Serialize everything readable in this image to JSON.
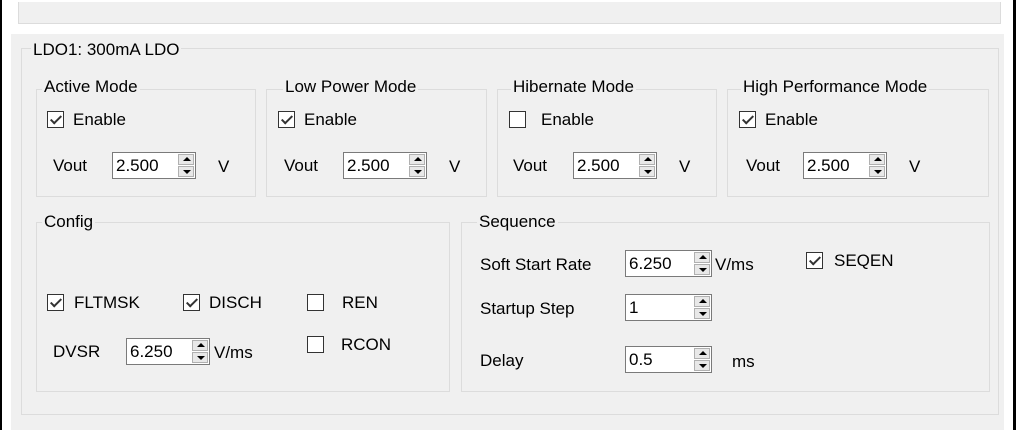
{
  "ldo": {
    "title": "LDO1: 300mA LDO",
    "modes": [
      {
        "label": "Active Mode",
        "enable_label": "Enable",
        "enabled": true,
        "vout_label": "Vout",
        "vout": "2.500",
        "unit": "V"
      },
      {
        "label": "Low Power Mode",
        "enable_label": "Enable",
        "enabled": true,
        "vout_label": "Vout",
        "vout": "2.500",
        "unit": "V"
      },
      {
        "label": "Hibernate Mode",
        "enable_label": "Enable",
        "enabled": false,
        "vout_label": "Vout",
        "vout": "2.500",
        "unit": "V"
      },
      {
        "label": "High Performance Mode",
        "enable_label": "Enable",
        "enabled": true,
        "vout_label": "Vout",
        "vout": "2.500",
        "unit": "V"
      }
    ],
    "config": {
      "label": "Config",
      "fltmsk": {
        "label": "FLTMSK",
        "checked": true
      },
      "disch": {
        "label": "DISCH",
        "checked": true
      },
      "ren": {
        "label": "REN",
        "checked": false
      },
      "rcon": {
        "label": "RCON",
        "checked": false
      },
      "dvsr_label": "DVSR",
      "dvsr": "6.250",
      "dvsr_unit": "V/ms"
    },
    "sequence": {
      "label": "Sequence",
      "soft_start_label": "Soft Start Rate",
      "soft_start": "6.250",
      "soft_start_unit": "V/ms",
      "seqen": {
        "label": "SEQEN",
        "checked": true
      },
      "startup_label": "Startup Step",
      "startup": "1",
      "delay_label": "Delay",
      "delay": "0.5",
      "delay_unit": "ms"
    }
  }
}
